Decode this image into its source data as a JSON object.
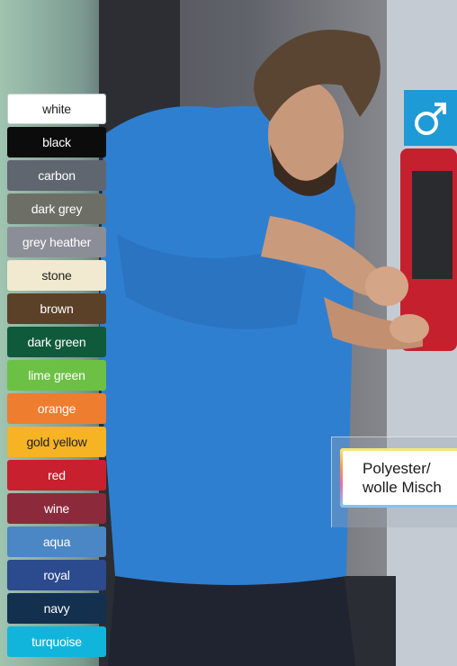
{
  "swatches": [
    {
      "label": "white",
      "bg": "#ffffff",
      "fg": "#222222",
      "border": "#cccccc"
    },
    {
      "label": "black",
      "bg": "#0c0c0c",
      "fg": "#ffffff"
    },
    {
      "label": "carbon",
      "bg": "#5f6670",
      "fg": "#ffffff"
    },
    {
      "label": "dark grey",
      "bg": "#6d6f66",
      "fg": "#ffffff"
    },
    {
      "label": "grey heather",
      "bg": "#8b8e97",
      "fg": "#ffffff"
    },
    {
      "label": "stone",
      "bg": "#f1ead0",
      "fg": "#222222"
    },
    {
      "label": "brown",
      "bg": "#5b4128",
      "fg": "#ffffff"
    },
    {
      "label": "dark green",
      "bg": "#0f5a3a",
      "fg": "#ffffff"
    },
    {
      "label": "lime green",
      "bg": "#6cc145",
      "fg": "#ffffff"
    },
    {
      "label": "orange",
      "bg": "#ef7d2f",
      "fg": "#ffffff"
    },
    {
      "label": "gold yellow",
      "bg": "#f6b323",
      "fg": "#222222"
    },
    {
      "label": "red",
      "bg": "#c8202e",
      "fg": "#ffffff"
    },
    {
      "label": "wine",
      "bg": "#8c2a3c",
      "fg": "#ffffff"
    },
    {
      "label": "aqua",
      "bg": "#4b86c5",
      "fg": "#ffffff"
    },
    {
      "label": "royal",
      "bg": "#2c4a8e",
      "fg": "#ffffff"
    },
    {
      "label": "navy",
      "bg": "#14304f",
      "fg": "#ffffff"
    },
    {
      "label": "turquoise",
      "bg": "#11b5dc",
      "fg": "#ffffff"
    }
  ],
  "gender_badge": {
    "icon": "male-symbol-icon",
    "color": "#1e9ad6"
  },
  "material": {
    "line1": "Polyester/",
    "line2": "wolle Misch"
  }
}
